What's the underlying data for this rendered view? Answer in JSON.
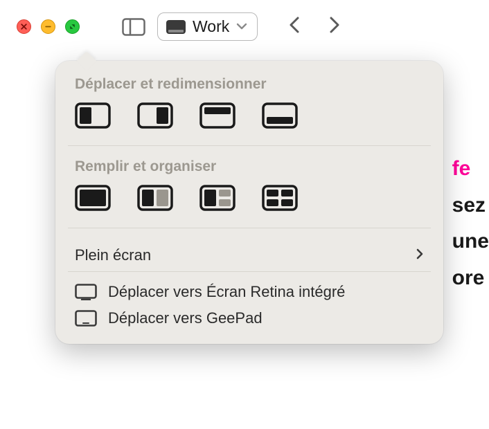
{
  "toolbar": {
    "tab_label": "Work"
  },
  "popover": {
    "section_move_resize": "Déplacer et redimensionner",
    "section_fill_arrange": "Remplir et organiser",
    "fullscreen_label": "Plein écran",
    "move_to_retina": "Déplacer vers Écran Retina intégré",
    "move_to_geepad": "Déplacer vers GeePad"
  },
  "background": {
    "line1_hl": "fe",
    "line2": "sez",
    "line3": "une",
    "line4": "ore"
  }
}
